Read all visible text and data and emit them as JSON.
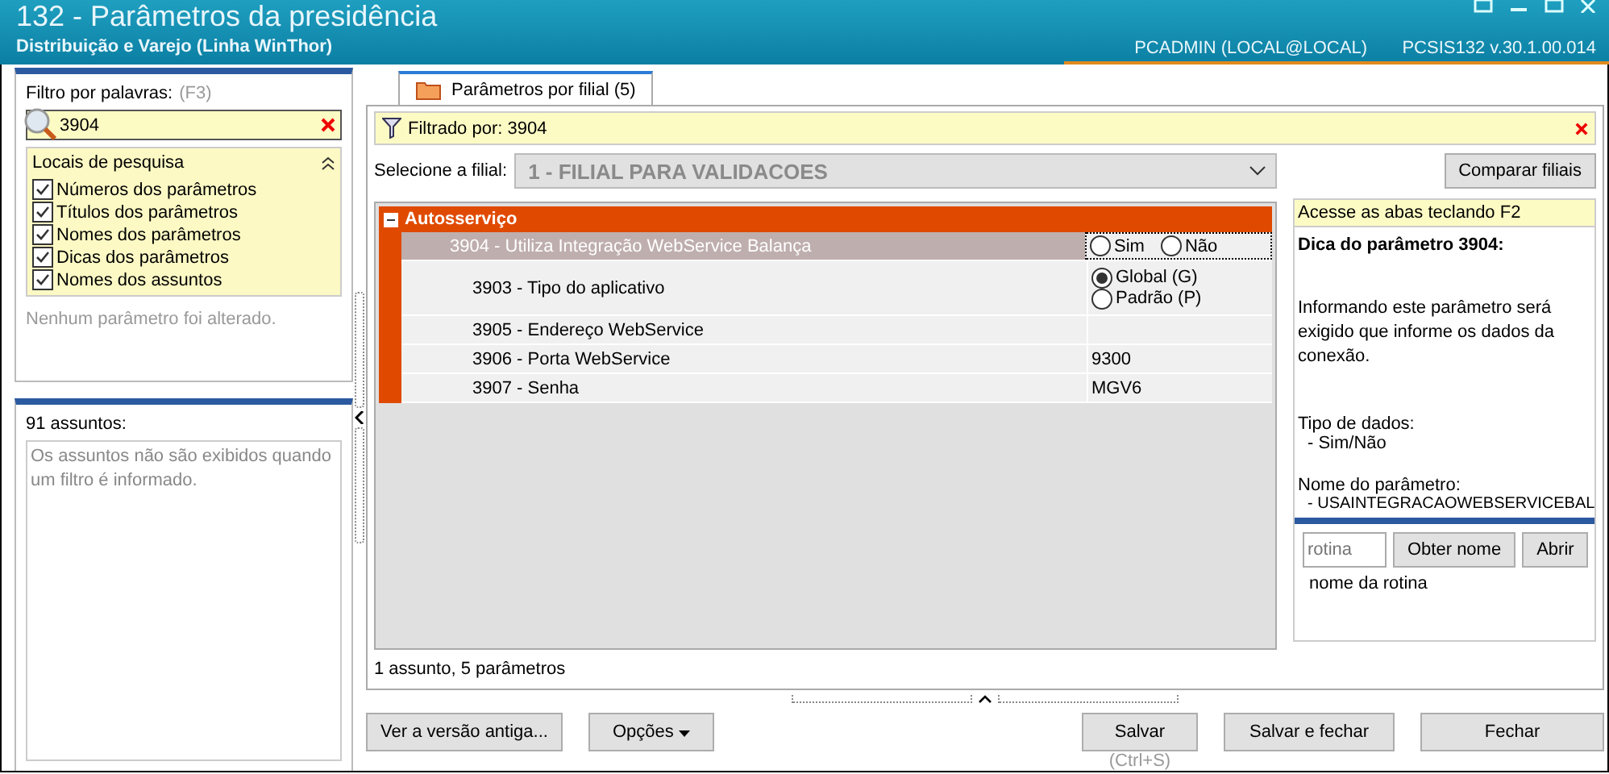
{
  "window": {
    "title": "132 - Parâmetros da presidência",
    "subtitle": "Distribuição e Varejo (Linha WinThor)",
    "user": "PCADMIN (LOCAL@LOCAL)",
    "version": "PCSIS132  v.30.1.00.014"
  },
  "filter_panel": {
    "label": "Filtro por palavras:",
    "shortcut": "(F3)",
    "search_value": "3904",
    "search_places": {
      "title": "Locais de pesquisa",
      "expanded": true,
      "options": [
        {
          "label": "Números dos parâmetros",
          "checked": true
        },
        {
          "label": "Títulos dos parâmetros",
          "checked": true
        },
        {
          "label": "Nomes dos parâmetros",
          "checked": true
        },
        {
          "label": "Dicas dos parâmetros",
          "checked": true
        },
        {
          "label": "Nomes dos assuntos",
          "checked": true
        }
      ]
    },
    "status": "Nenhum parâmetro foi alterado."
  },
  "subjects_panel": {
    "count": "91 assuntos:",
    "message": "Os assuntos não são exibidos quando um filtro é informado."
  },
  "tabs": [
    {
      "label": "Parâmetros por filial",
      "count": "(5)",
      "selected": true
    }
  ],
  "filter_bar": {
    "text": "Filtrado por: 3904"
  },
  "branch_select": {
    "label": "Selecione a filial:",
    "value": "1 - FILIAL PARA VALIDACOES"
  },
  "compare_button": "Comparar filiais",
  "groups": [
    {
      "title": "Autosserviço",
      "expanded": true,
      "parameters": [
        {
          "label": "3904 - Utiliza Integração WebService Balança",
          "selected": true,
          "kind": "radio",
          "options": [
            {
              "label": "Sim",
              "selected": false
            },
            {
              "label": "Não",
              "selected": false
            }
          ],
          "children": [
            {
              "label": "3903 - Tipo do aplicativo",
              "selected": false,
              "kind": "radio",
              "options": [
                {
                  "label": "Global (G)",
                  "selected": true
                },
                {
                  "label": "Padrão (P)",
                  "selected": false
                }
              ]
            },
            {
              "label": "3905 - Endereço WebService",
              "selected": false,
              "kind": "text"
            },
            {
              "label": "3906 - Porta WebService",
              "selected": false,
              "kind": "text",
              "value": "9300"
            },
            {
              "label": "3907 - Senha",
              "selected": false,
              "kind": "text",
              "value": "MGV6"
            }
          ]
        }
      ]
    }
  ],
  "grid_footer": "1 assunto, 5 parâmetros",
  "hint_panel": {
    "notice": "Acesse as abas teclando F2",
    "title": "Dica do parâmetro 3904:",
    "description": "Informando este parâmetro será exigido que informe os dados da conexão.",
    "data_type_label": "Tipo de dados:",
    "data_type": "- Sim/Não",
    "name_label": "Nome do parâmetro:",
    "name": "- USAINTEGRACAOWEBSERVICEBAL"
  },
  "routine_panel": {
    "placeholder": "rotina",
    "get_name_button": "Obter nome",
    "open_button": "Abrir",
    "result": "nome da rotina"
  },
  "buttons": {
    "old_version": "Ver a versão antiga...",
    "options": "Opções",
    "save": "Salvar",
    "save_shortcut": "(Ctrl+S)",
    "save_close": "Salvar e fechar",
    "close": "Fechar"
  }
}
